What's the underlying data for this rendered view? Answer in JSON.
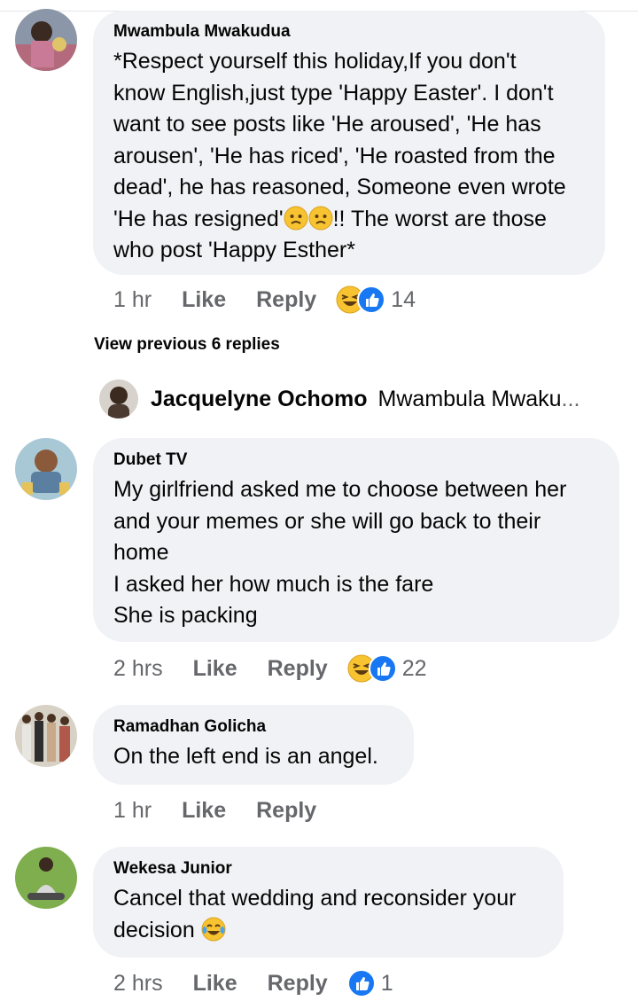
{
  "comments": [
    {
      "author": "Mwambula Mwakudua",
      "lines": [
        "*Respect yourself this holiday,If you don't",
        "know English,just type 'Happy Easter'. I don't",
        "want to see posts like 'He aroused', 'He has",
        "arousen', 'He has riced', 'He roasted from the",
        "dead', he has reasoned, Someone even wrote",
        "'He has resigned'",
        "!! The worst are those",
        "who post 'Happy Esther*"
      ],
      "time": "1 hr",
      "like": "Like",
      "reply": "Reply",
      "reaction_count": "14",
      "reaction_icons": [
        "laughing-emoji",
        "like-thumb"
      ],
      "inline_icons": [
        "worried-emoji",
        "worried-emoji"
      ]
    },
    {
      "author": "Dubet TV",
      "lines": [
        "My girlfriend asked me to choose between her",
        "and your memes or she will go back to their",
        "home",
        "I asked her how much is the fare",
        "She is packing"
      ],
      "time": "2 hrs",
      "like": "Like",
      "reply": "Reply",
      "reaction_count": "22",
      "reaction_icons": [
        "laughing-emoji",
        "like-thumb"
      ]
    },
    {
      "author": "Ramadhan Golicha",
      "lines": [
        "On the left end is an angel."
      ],
      "time": "1 hr",
      "like": "Like",
      "reply": "Reply"
    },
    {
      "author": "Wekesa Junior",
      "lines": [
        "Cancel that wedding and reconsider your",
        "decision"
      ],
      "time": "2 hrs",
      "like": "Like",
      "reply": "Reply",
      "reaction_count": "1",
      "reaction_icons": [
        "like-thumb"
      ],
      "inline_icons": [
        "tears-of-joy-emoji"
      ]
    }
  ],
  "view_previous": "View previous 6 replies",
  "reply_preview": {
    "author": "Jacquelyne Ochomo",
    "text": "Mwambula Mwaku",
    "ellipsis": "..."
  },
  "colors": {
    "bubble": "#f0f2f5",
    "meta_text": "#65676b",
    "like_blue": "#1877f2",
    "emoji_yellow": "#f7c331"
  }
}
